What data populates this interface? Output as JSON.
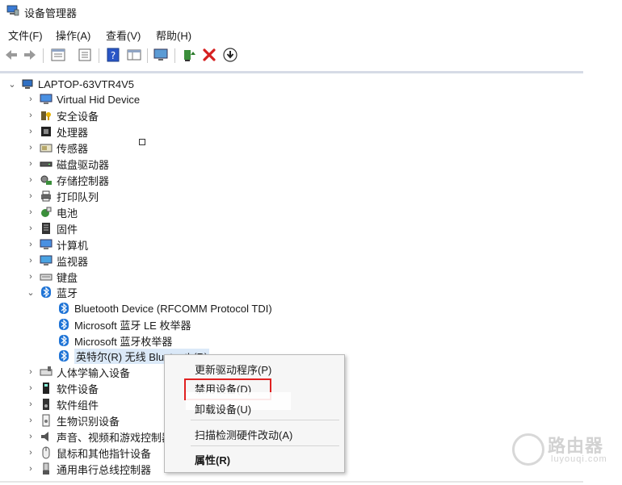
{
  "window": {
    "title": "设备管理器"
  },
  "menubar": {
    "items": [
      "文件(F)",
      "操作(A)",
      "查看(V)",
      "帮助(H)"
    ]
  },
  "toolbar": {
    "icons": [
      "back-icon",
      "forward-icon",
      "properties-icon",
      "list-icon",
      "help-icon",
      "view-icon",
      "monitor-icon",
      "update-driver-icon",
      "uninstall-icon",
      "download-icon"
    ]
  },
  "tree": {
    "root": "LAPTOP-63VTR4V5",
    "categories": [
      "Virtual Hid Device",
      "安全设备",
      "处理器",
      "传感器",
      "磁盘驱动器",
      "存储控制器",
      "打印队列",
      "电池",
      "固件",
      "计算机",
      "监视器",
      "键盘",
      "蓝牙"
    ],
    "bluetooth_children": [
      "Bluetooth Device (RFCOMM Protocol TDI)",
      "Microsoft 蓝牙 LE 枚举器",
      "Microsoft 蓝牙枚举器",
      "英特尔(R) 无线 Bluetooth(R)"
    ],
    "more_categories": [
      "人体学输入设备",
      "软件设备",
      "软件组件",
      "生物识别设备",
      "声音、视频和游戏控制器",
      "鼠标和其他指针设备",
      "通用串行总线控制器"
    ]
  },
  "context_menu": {
    "items": [
      "更新驱动程序(P)",
      "禁用设备(D)",
      "卸载设备(U)",
      "扫描检测硬件改动(A)",
      "属性(R)"
    ]
  },
  "watermark": {
    "name": "路由器",
    "url": "luyouqi.com"
  },
  "colors": {
    "highlight_border": "#e02020",
    "bluetooth_blue": "#1f74d6",
    "selection_bg": "#dbe9f8"
  }
}
